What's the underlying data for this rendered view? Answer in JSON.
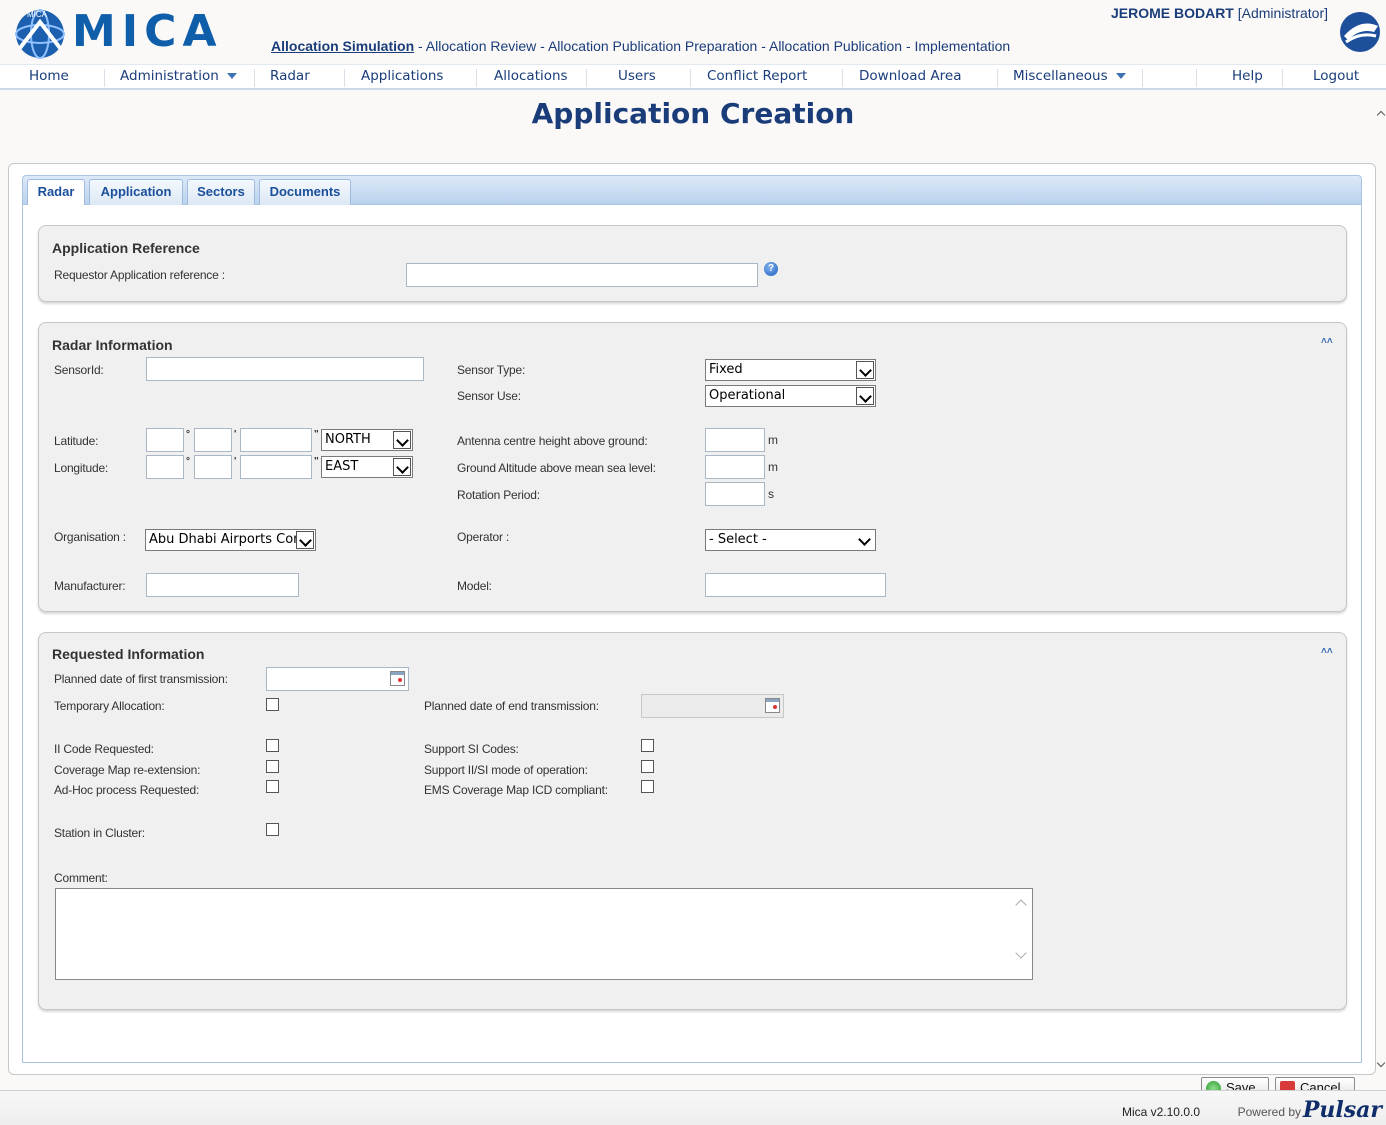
{
  "header": {
    "app_name": "MICA",
    "logo_small_text": "MICA",
    "user_name": "JEROME BODART",
    "user_role": "[Administrator]",
    "workflow_active": "Allocation Simulation",
    "workflow_rest": " - Allocation Review - Allocation Publication Preparation - Allocation Publication - Implementation"
  },
  "nav": {
    "home": "Home",
    "administration": "Administration",
    "radar": "Radar",
    "applications": "Applications",
    "allocations": "Allocations",
    "users": "Users",
    "conflict_report": "Conflict Report",
    "download_area": "Download Area",
    "miscellaneous": "Miscellaneous",
    "help": "Help",
    "logout": "Logout"
  },
  "page_title": "Application Creation",
  "tabs": {
    "radar": "Radar",
    "application": "Application",
    "sectors": "Sectors",
    "documents": "Documents"
  },
  "app_ref": {
    "legend": "Application Reference",
    "requestor_label": "Requestor Application reference :",
    "requestor_value": "",
    "help_glyph": "?"
  },
  "radar_info": {
    "legend": "Radar Information",
    "collapse_glyph": "˄˄",
    "sensor_id_label": "SensorId:",
    "sensor_type_label": "Sensor Type:",
    "sensor_type_value": "Fixed",
    "sensor_use_label": "Sensor Use:",
    "sensor_use_value": "Operational",
    "latitude_label": "Latitude:",
    "latitude_hemisphere": "NORTH",
    "longitude_label": "Longitude:",
    "longitude_hemisphere": "EAST",
    "deg_symbol": "°",
    "min_symbol": "'",
    "sec_symbol": "\"",
    "antenna_label": "Antenna centre height above ground:",
    "antenna_unit": "m",
    "ground_alt_label": "Ground Altitude above mean sea level:",
    "ground_alt_unit": "m",
    "rotation_label": "Rotation Period:",
    "rotation_unit": "s",
    "organisation_label": "Organisation :",
    "organisation_value": "Abu Dhabi Airports Com",
    "operator_label": "Operator :",
    "operator_value": "- Select -",
    "manufacturer_label": "Manufacturer:",
    "model_label": "Model:"
  },
  "requested_info": {
    "legend": "Requested Information",
    "collapse_glyph": "˄˄",
    "first_tx_label": "Planned date of first transmission:",
    "temp_alloc_label": "Temporary Allocation:",
    "end_tx_label": "Planned date of end transmission:",
    "ii_code_label": "II Code Requested:",
    "support_si_label": "Support SI Codes:",
    "coverage_map_label": "Coverage Map re-extension:",
    "support_iisi_label": "Support II/SI mode of operation:",
    "adhoc_label": "Ad-Hoc process Requested:",
    "ems_label": "EMS Coverage Map ICD compliant:",
    "station_cluster_label": "Station in Cluster:",
    "comment_label": "Comment:"
  },
  "buttons": {
    "save": "Save",
    "cancel": "Cancel"
  },
  "footer": {
    "version": "Mica v2.10.0.0",
    "powered_by": "Powered by",
    "brand": "Pulsar"
  }
}
